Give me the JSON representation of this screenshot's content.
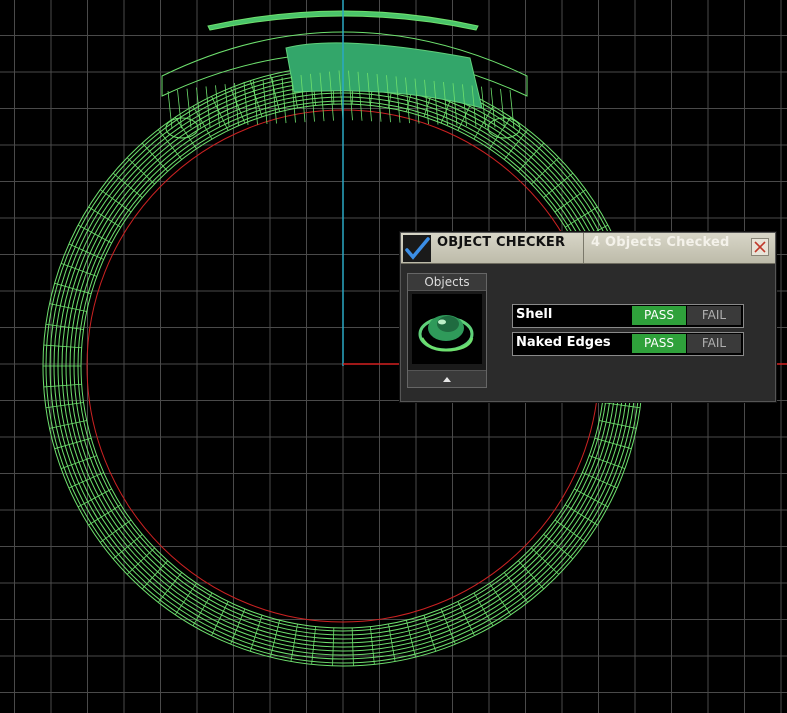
{
  "viewport": {
    "background": "#000000",
    "grid_color": "#4a4a4a",
    "model_color": "#6ee06e",
    "construction_circle_color": "#cc2222",
    "y_axis_color": "#2aa8c4",
    "x_axis_color": "#d42020"
  },
  "object_checker": {
    "title": "OBJECT CHECKER",
    "objects_checked": "4  Objects Checked",
    "close_icon": "close-icon",
    "objects_header": "Objects",
    "scroll_icon": "scroll-up-icon",
    "checks": [
      {
        "name": "Shell",
        "pass": "PASS",
        "fail": "FAIL",
        "result": "pass"
      },
      {
        "name": "Naked Edges",
        "pass": "PASS",
        "fail": "FAIL",
        "result": "pass"
      }
    ],
    "pass_color": "#2fa13b"
  }
}
